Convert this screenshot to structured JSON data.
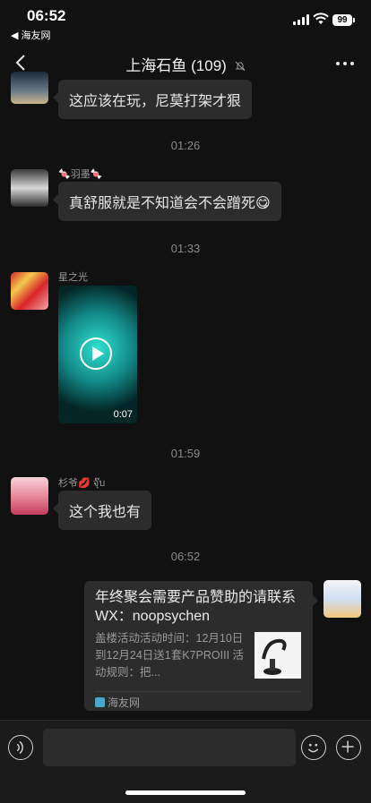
{
  "status_bar": {
    "time": "06:52",
    "back_app": "◀ 海友网",
    "battery": "99"
  },
  "nav": {
    "title": "上海石鱼 (109)"
  },
  "messages": [
    {
      "text": "这应该在玩，尼莫打架才狠"
    },
    {
      "timestamp": "01:26"
    },
    {
      "nickname": "🍬羽墨🍬",
      "text": "真舒服就是不知道会不会蹭死😋"
    },
    {
      "timestamp": "01:33"
    },
    {
      "nickname": "星之光",
      "video_duration": "0:07"
    },
    {
      "timestamp": "01:59"
    },
    {
      "nickname": "杉爷💋 จุ๊บ",
      "text": "这个我也有"
    },
    {
      "timestamp": "06:52"
    }
  ],
  "link_card": {
    "title": "年终聚会需要产品赞助的请联系 WX：noopsychen",
    "description": "盖楼活动活动时间：12月10日到12月24日送1套K7PROIII 活动规则：把...",
    "source": "海友网"
  },
  "colors": {
    "background": "#111111",
    "bubble": "#2c2c2c",
    "muted_text": "#9a9a9a"
  }
}
